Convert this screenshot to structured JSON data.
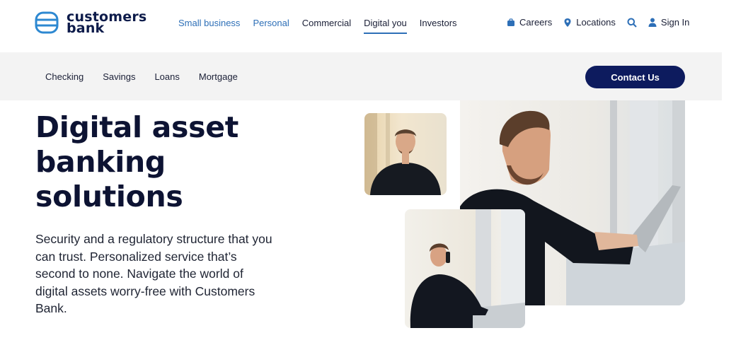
{
  "brand": {
    "line1": "customers",
    "line2": "bank"
  },
  "main_nav": [
    {
      "label": "Small business"
    },
    {
      "label": "Personal"
    },
    {
      "label": "Commercial"
    },
    {
      "label": "Digital you"
    },
    {
      "label": "Investors"
    }
  ],
  "utility_nav": {
    "careers": "Careers",
    "locations": "Locations",
    "sign_in": "Sign In"
  },
  "sub_nav": [
    {
      "label": "Checking"
    },
    {
      "label": "Savings"
    },
    {
      "label": "Loans"
    },
    {
      "label": "Mortgage"
    }
  ],
  "contact_button": "Contact Us",
  "hero": {
    "title_lines": [
      "Digital asset",
      "banking",
      "solutions"
    ],
    "body": "Security and a regulatory structure that you can trust. Personalized service that’s second to none. Navigate the world of digital assets worry-free with Customers Bank."
  },
  "colors": {
    "brand_navy": "#0d1b5e",
    "link_blue": "#2d6fb7",
    "subbar_bg": "#f3f3f3"
  },
  "icons": [
    "logo-mark-icon",
    "briefcase-icon",
    "location-pin-icon",
    "search-icon",
    "user-icon"
  ]
}
